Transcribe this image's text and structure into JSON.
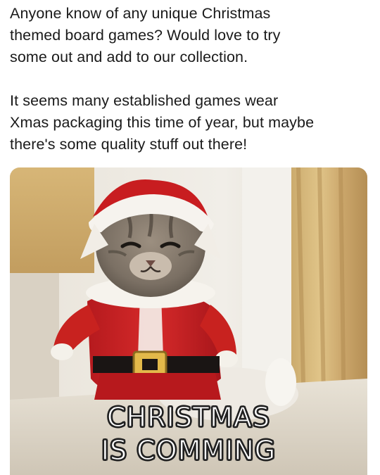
{
  "post": {
    "paragraph_1": "Anyone know of any unique Christmas\nthemed board games? Would love to try\nsome out and add to our collection.",
    "paragraph_2": "It seems many established games wear\nXmas packaging this time of year, but maybe\nthere's some quality stuff out there!"
  },
  "media": {
    "type": "gif",
    "subject": "kitten-in-santa-suit",
    "caption_line_1": "CHRISTMAS",
    "caption_line_2": "IS COMMING"
  }
}
